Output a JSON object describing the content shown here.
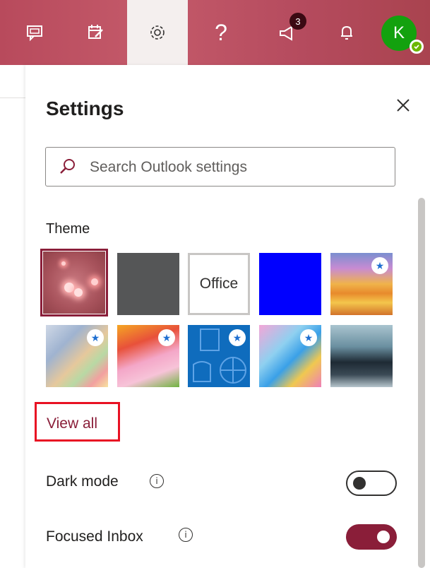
{
  "topbar": {
    "buttons": [
      "chat-icon",
      "tasks-icon",
      "gear-icon",
      "help-icon",
      "megaphone-icon",
      "bell-icon"
    ],
    "help_glyph": "?",
    "whats_new_badge": "3",
    "avatar_initial": "K"
  },
  "settings": {
    "title": "Settings",
    "search_placeholder": "Search Outlook settings",
    "theme": {
      "label": "Theme",
      "tiles": [
        {
          "name": "red-bokeh",
          "selected": true,
          "premium": false
        },
        {
          "name": "dark-gray",
          "selected": false,
          "premium": false
        },
        {
          "name": "office",
          "label": "Office",
          "selected": false,
          "premium": false
        },
        {
          "name": "blue",
          "selected": false,
          "premium": false
        },
        {
          "name": "colorful-waves",
          "selected": false,
          "premium": true
        },
        {
          "name": "rainbow-ribbons",
          "selected": false,
          "premium": true
        },
        {
          "name": "pink-dragon",
          "selected": false,
          "premium": true
        },
        {
          "name": "blue-sports",
          "selected": false,
          "premium": true
        },
        {
          "name": "game-board",
          "selected": false,
          "premium": true
        },
        {
          "name": "mountain",
          "selected": false,
          "premium": false
        }
      ],
      "view_all": "View all"
    },
    "dark_mode": {
      "label": "Dark mode",
      "enabled": false
    },
    "focused_inbox": {
      "label": "Focused Inbox",
      "enabled": true
    },
    "info_glyph": "i"
  }
}
